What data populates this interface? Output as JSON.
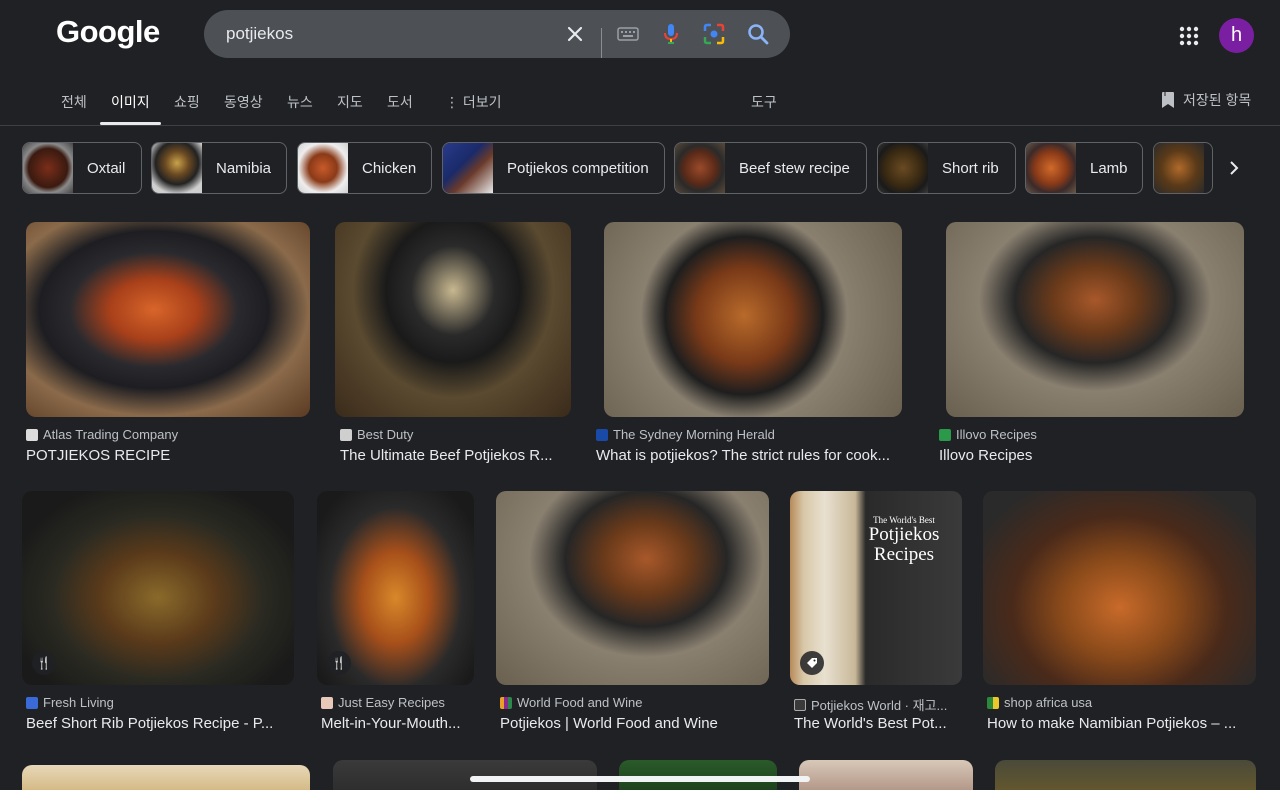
{
  "logo": "Google",
  "search": {
    "value": "potjiekos"
  },
  "avatar_letter": "h",
  "tabs": [
    "전체",
    "이미지",
    "쇼핑",
    "동영상",
    "뉴스",
    "지도",
    "도서",
    "더보기",
    "도구"
  ],
  "saved_label": "저장된 항목",
  "chips": [
    "Oxtail",
    "Namibia",
    "Chicken",
    "Potjiekos competition",
    "Beef stew recipe",
    "Short rib",
    "Lamb"
  ],
  "results": [
    {
      "source": "Atlas Trading Company",
      "title": "POTJIEKOS RECIPE"
    },
    {
      "source": "Best Duty",
      "title": "The Ultimate Beef Potjiekos R..."
    },
    {
      "source": "The Sydney Morning Herald",
      "title": "What is potjiekos? The strict rules for cook..."
    },
    {
      "source": "Illovo Recipes",
      "title": "Illovo Recipes"
    },
    {
      "source": "Fresh Living",
      "title": "Beef Short Rib Potjiekos Recipe - P..."
    },
    {
      "source": "Just Easy Recipes",
      "title": "Melt-in-Your-Mouth..."
    },
    {
      "source": "World Food and Wine",
      "title": "Potjiekos | World Food and Wine"
    },
    {
      "source": "Potjiekos World · 재고...",
      "title": "The World's Best Pot..."
    },
    {
      "source": "shop africa usa",
      "title": "How to make Namibian Potjiekos – ..."
    }
  ],
  "book": {
    "line1": "The World's Best",
    "line2": "Potjiekos",
    "line3": "Recipes"
  },
  "colors": {
    "background": "#202124",
    "search_bg": "#4d5156",
    "avatar": "#7b1fa2"
  }
}
